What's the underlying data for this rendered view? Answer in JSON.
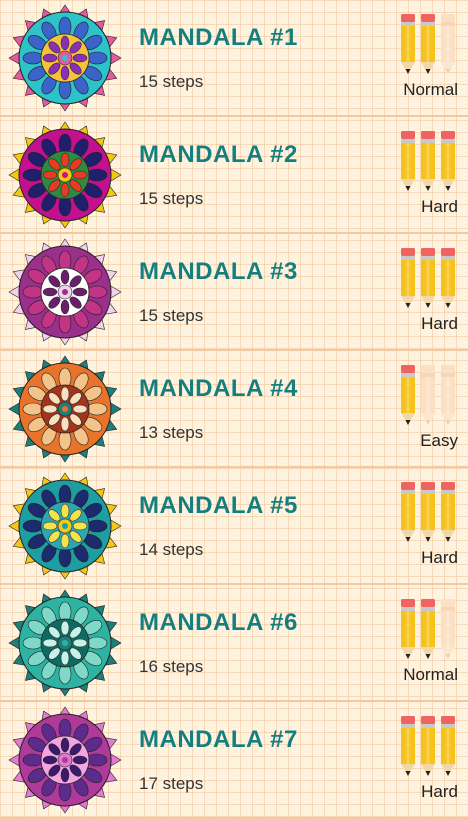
{
  "colors": {
    "title": "#157f80",
    "pencil_active_body": "#f6c21c",
    "pencil_active_eraser": "#ef6461",
    "pencil_inactive_body": "#fbe0c4"
  },
  "mandalas": [
    {
      "title": "MANDALA #1",
      "steps": "15 steps",
      "difficulty": "Normal",
      "level": 2,
      "palette": [
        "#2dc3c9",
        "#e35aa0",
        "#3a64c9",
        "#f4c33a",
        "#8b2fb5"
      ]
    },
    {
      "title": "MANDALA #2",
      "steps": "15 steps",
      "difficulty": "Hard",
      "level": 3,
      "palette": [
        "#c3108f",
        "#f2c813",
        "#1f1f6b",
        "#2d8a3e",
        "#e83b24"
      ]
    },
    {
      "title": "MANDALA #3",
      "steps": "15 steps",
      "difficulty": "Hard",
      "level": 3,
      "palette": [
        "#9b2f8c",
        "#f3d1ea",
        "#c13584",
        "#ffffff",
        "#6a1f6a"
      ]
    },
    {
      "title": "MANDALA #4",
      "steps": "13 steps",
      "difficulty": "Easy",
      "level": 1,
      "palette": [
        "#e8732b",
        "#1e7f7a",
        "#f4c38a",
        "#a2331c",
        "#f6e1c0"
      ]
    },
    {
      "title": "MANDALA #5",
      "steps": "14 steps",
      "difficulty": "Hard",
      "level": 3,
      "palette": [
        "#1e9ea0",
        "#f2c818",
        "#1c2a6e",
        "#2ca6b0",
        "#f6e24a"
      ]
    },
    {
      "title": "MANDALA #6",
      "steps": "16 steps",
      "difficulty": "Normal",
      "level": 2,
      "palette": [
        "#2cb3a1",
        "#1f7f78",
        "#7fd8c8",
        "#106a64",
        "#c8f1e8"
      ]
    },
    {
      "title": "MANDALA #7",
      "steps": "17 steps",
      "difficulty": "Hard",
      "level": 3,
      "palette": [
        "#b03a9a",
        "#e27bd0",
        "#5c2b8c",
        "#f4a4e1",
        "#3a1a6a"
      ]
    }
  ]
}
